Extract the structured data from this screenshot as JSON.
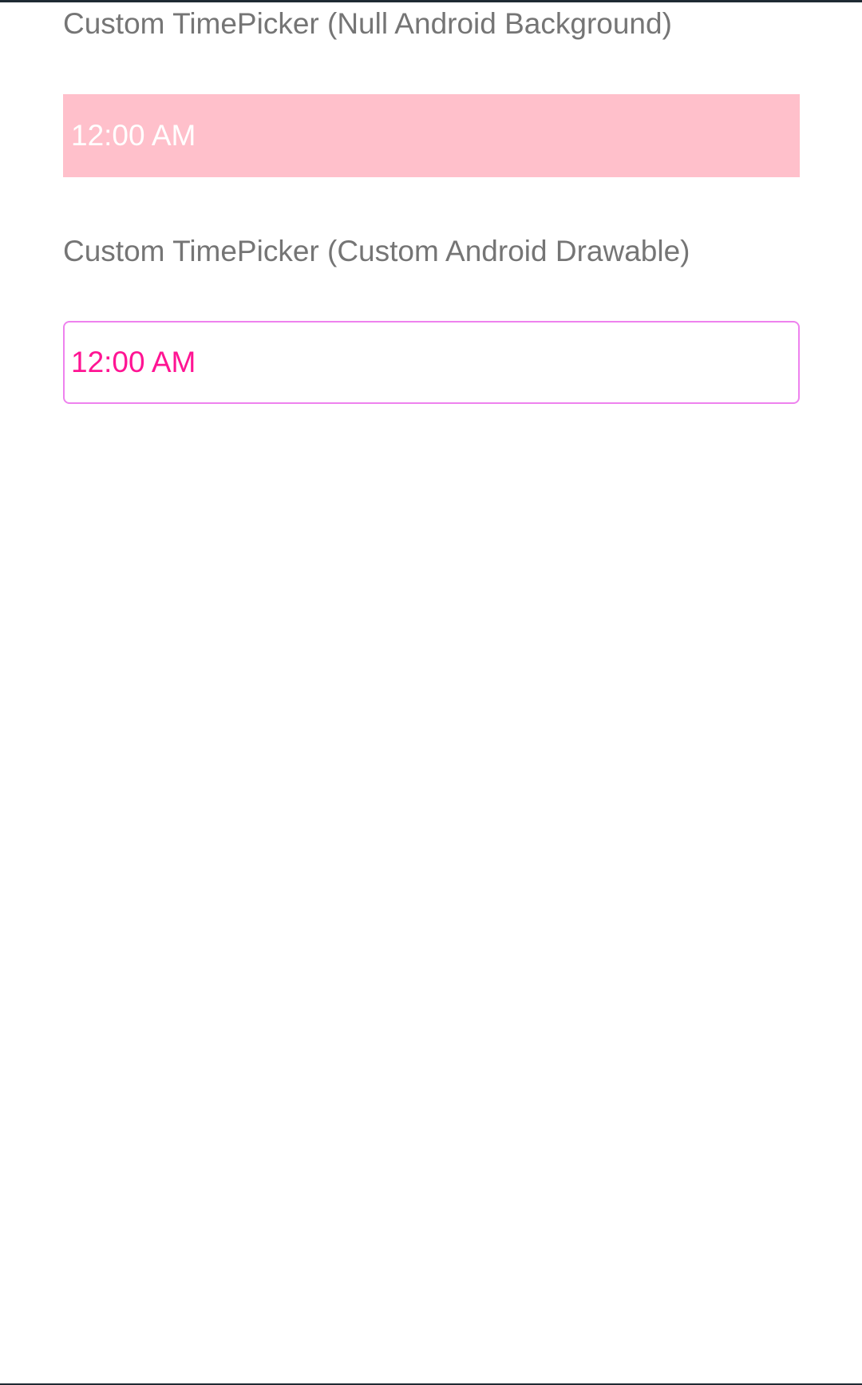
{
  "colors": {
    "label_text": "#757575",
    "null_picker_background": "#ffc0cb",
    "null_picker_text": "#ffffff",
    "drawable_picker_border": "#ee82ee",
    "drawable_picker_text": "#ff1493"
  },
  "sections": [
    {
      "label": "Custom TimePicker (Null Android Background)",
      "time_value": "12:00 AM"
    },
    {
      "label": "Custom TimePicker (Custom Android Drawable)",
      "time_value": "12:00 AM"
    }
  ]
}
